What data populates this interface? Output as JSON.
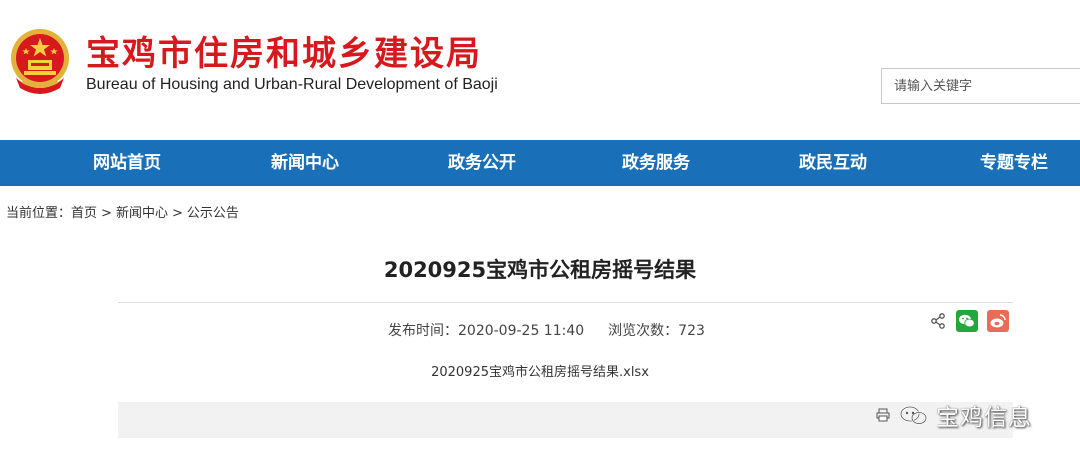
{
  "header": {
    "title_cn": "宝鸡市住房和城乡建设局",
    "title_en": "Bureau of Housing and Urban-Rural Development of Baoji",
    "emblem_icon": "national-emblem-icon",
    "search": {
      "placeholder": "请输入关键字",
      "value": ""
    }
  },
  "nav": {
    "items": [
      {
        "label": "网站首页"
      },
      {
        "label": "新闻中心"
      },
      {
        "label": "政务公开"
      },
      {
        "label": "政务服务"
      },
      {
        "label": "政民互动"
      },
      {
        "label": "专题专栏"
      }
    ]
  },
  "breadcrumb": {
    "prefix": "当前位置：",
    "items": [
      "首页",
      "新闻中心",
      "公示公告"
    ]
  },
  "article": {
    "title": "2020925宝鸡市公租房摇号结果",
    "publish_label": "发布时间：",
    "publish_time": "2020-09-25 11:40",
    "views_label": "浏览次数：",
    "views": "723",
    "attachment": "2020925宝鸡市公租房摇号结果.xlsx"
  },
  "share": {
    "icons": [
      "share-icon",
      "wechat-icon",
      "weibo-icon"
    ]
  },
  "watermark": {
    "text": "宝鸡信息"
  },
  "colors": {
    "brand_red": "#d7191e",
    "nav_blue": "#1a70b8",
    "wechat_green": "#22a83a",
    "weibo_red": "#e96d56"
  }
}
